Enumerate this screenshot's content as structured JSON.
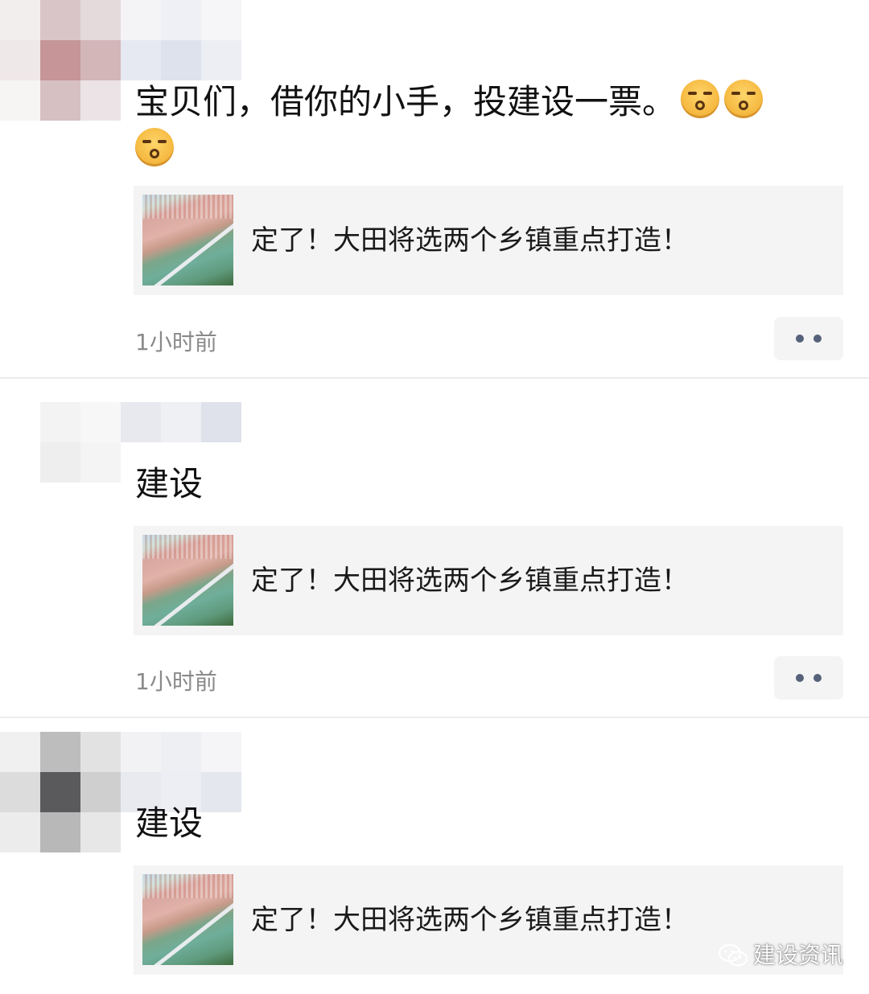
{
  "posts": [
    {
      "text": "宝贝们，借你的小手，投建设一票。",
      "emoji_count": 3,
      "emoji_icon": "kiss-face-icon",
      "card_title": "定了！大田将选两个乡镇重点打造！",
      "time": "1小时前"
    },
    {
      "text": "建设",
      "card_title": "定了！大田将选两个乡镇重点打造！",
      "time": "1小时前"
    },
    {
      "text": "建设",
      "card_title": "定了！大田将选两个乡镇重点打造！"
    }
  ],
  "watermark": {
    "label": "建设资讯",
    "icon": "wechat-icon"
  }
}
